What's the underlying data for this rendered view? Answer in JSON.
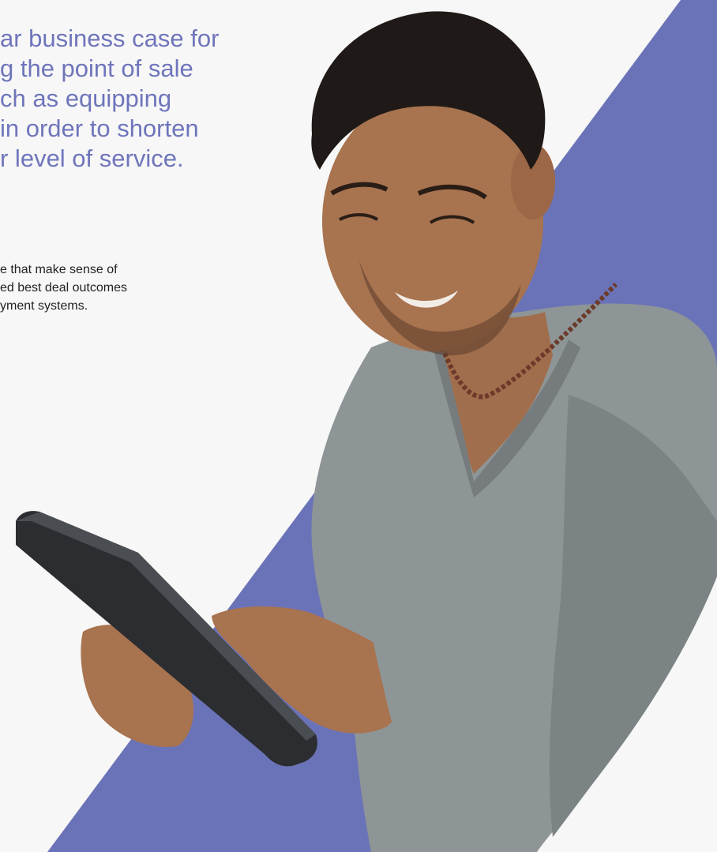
{
  "colors": {
    "accent_stripe": "#6b73b8",
    "headline_text": "#6f75bb",
    "body_text": "#222222",
    "background": "#f7f7f7"
  },
  "headline": {
    "lines": [
      "ar business case for",
      "g the point of sale",
      "ch as equipping",
      "in order to shorten",
      "r level of service."
    ]
  },
  "body": {
    "lines": [
      "e that make sense of",
      "ed best deal outcomes",
      "yment systems."
    ]
  },
  "photo": {
    "icon": "man-with-tablet-photo"
  }
}
